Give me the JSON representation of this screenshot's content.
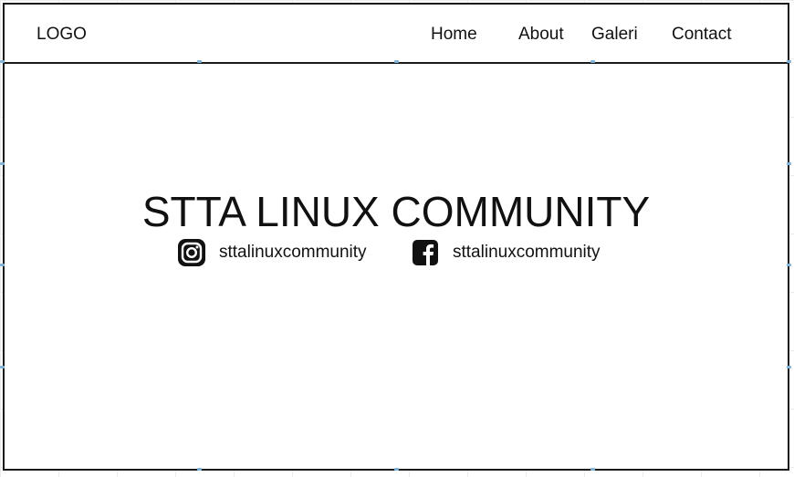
{
  "navbar": {
    "logo": "LOGO",
    "links": [
      "Home",
      "About",
      "Galeri",
      "Contact"
    ]
  },
  "hero": {
    "title": "STTA LINUX COMMUNITY",
    "socials": [
      {
        "icon": "instagram-icon",
        "handle": "sttalinuxcommunity"
      },
      {
        "icon": "facebook-icon",
        "handle": "sttalinuxcommunity"
      }
    ]
  },
  "colors": {
    "border": "#1a1a1a",
    "text": "#111111",
    "grid": "#ececec",
    "selection_handle": "#7fb2d9"
  }
}
